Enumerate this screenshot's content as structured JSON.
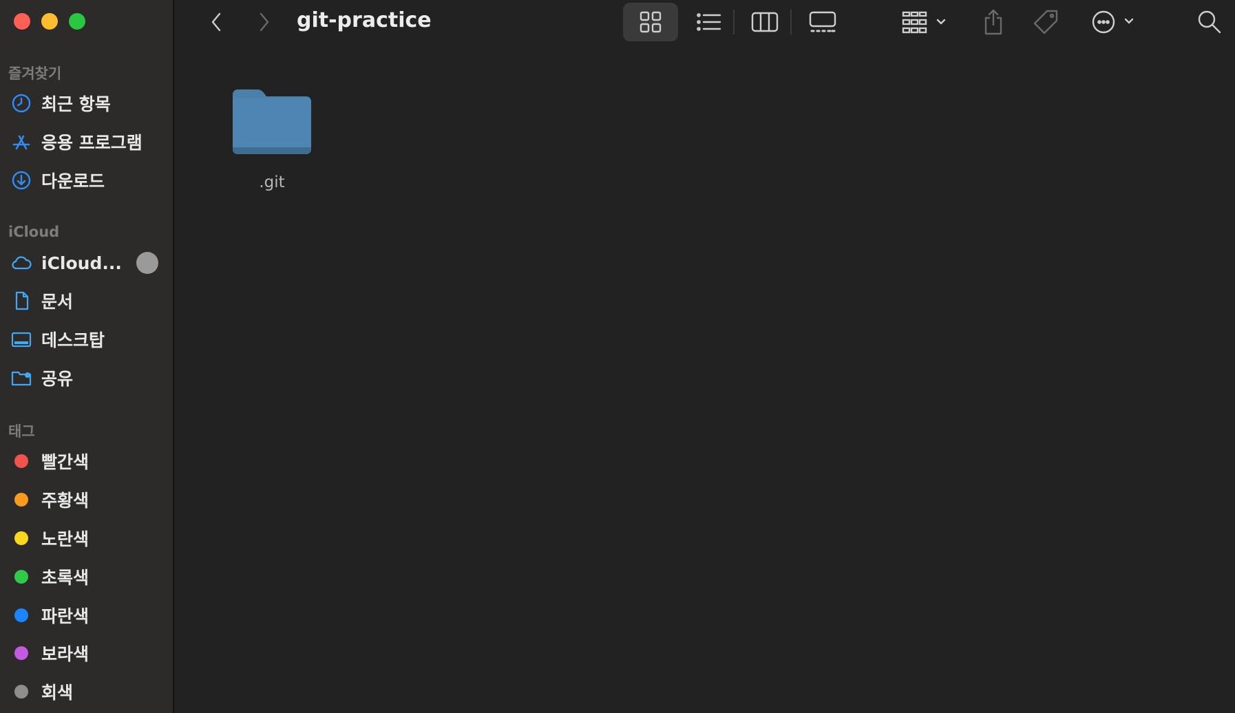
{
  "window": {
    "title": "git-practice"
  },
  "traffic_lights": {
    "close": "#fe5f57",
    "minimize": "#febc2e",
    "zoom": "#28c840"
  },
  "sidebar": {
    "favorites_header": "즐겨찾기",
    "favorites": [
      {
        "label": "최근 항목",
        "icon": "clock-icon"
      },
      {
        "label": "응용 프로그램",
        "icon": "app-store-icon"
      },
      {
        "label": "다운로드",
        "icon": "download-icon"
      }
    ],
    "icloud_header": "iCloud",
    "icloud": [
      {
        "label": "iCloud...",
        "icon": "cloud-icon"
      },
      {
        "label": "문서",
        "icon": "document-icon"
      },
      {
        "label": "데스크탑",
        "icon": "desktop-icon"
      },
      {
        "label": "공유",
        "icon": "shared-folder-icon"
      }
    ],
    "tags_header": "태그",
    "tags": [
      {
        "label": "빨간색",
        "color": "#f2534c"
      },
      {
        "label": "주황색",
        "color": "#f79a1e"
      },
      {
        "label": "노란색",
        "color": "#f7d81c"
      },
      {
        "label": "초록색",
        "color": "#2fca48"
      },
      {
        "label": "파란색",
        "color": "#1c85fb"
      },
      {
        "label": "보라색",
        "color": "#c45ae0"
      },
      {
        "label": "회색",
        "color": "#8e8e8e"
      }
    ]
  },
  "toolbar": {
    "view_mode": "icon",
    "icons": [
      "back-icon",
      "forward-icon",
      "icon-view-icon",
      "list-view-icon",
      "column-view-icon",
      "gallery-view-icon",
      "group-icon",
      "share-icon",
      "tag-icon",
      "more-icon",
      "search-icon"
    ]
  },
  "content": {
    "items": [
      {
        "name": ".git",
        "kind": "folder",
        "icon": "folder-icon"
      }
    ]
  },
  "accent_color": "#2e8df5"
}
